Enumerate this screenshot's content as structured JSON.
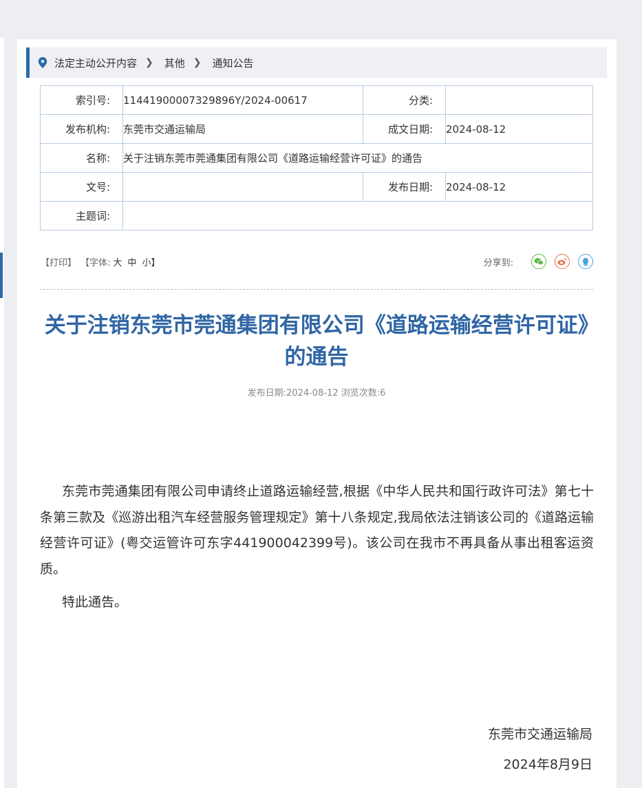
{
  "breadcrumb": {
    "items": [
      "法定主动公开内容",
      "其他",
      "通知公告"
    ]
  },
  "meta": {
    "index_label": "索引号:",
    "index_value": "11441900007329896Y/2024-00617",
    "category_label": "分类:",
    "category_value": "",
    "publisher_label": "发布机构:",
    "publisher_value": "东莞市交通运输局",
    "written_date_label": "成文日期:",
    "written_date_value": "2024-08-12",
    "name_label": "名称:",
    "name_value": "关于注销东莞市莞通集团有限公司《道路运输经营许可证》的通告",
    "doc_no_label": "文号:",
    "doc_no_value": "",
    "publish_date_label": "发布日期:",
    "publish_date_value": "2024-08-12",
    "subject_label": "主题词:",
    "subject_value": ""
  },
  "tools": {
    "print": "【打印】",
    "font_prefix": "【字体:",
    "font_large": "大",
    "font_medium": "中",
    "font_small": "小】",
    "share_label": "分享到:"
  },
  "article": {
    "title": "关于注销东莞市莞通集团有限公司《道路运输经营许可证》的通告",
    "pubinfo": "发布日期:2024-08-12  浏览次数:6",
    "paragraph1": "东莞市莞通集团有限公司申请终止道路运输经营,根据《中华人民共和国行政许可法》第七十条第三款及《巡游出租汽车经营服务管理规定》第十八条规定,我局依法注销该公司的《道路运输经营许可证》(粤交运管许可东字441900042399号)。该公司在我市不再具备从事出租客运资质。",
    "paragraph2": "特此通告。",
    "sign_org": "东莞市交通运输局",
    "sign_date": "2024年8月9日"
  },
  "colors": {
    "accent": "#2d6aa8",
    "title": "#2f66a4",
    "table_border": "#b8cce0"
  }
}
